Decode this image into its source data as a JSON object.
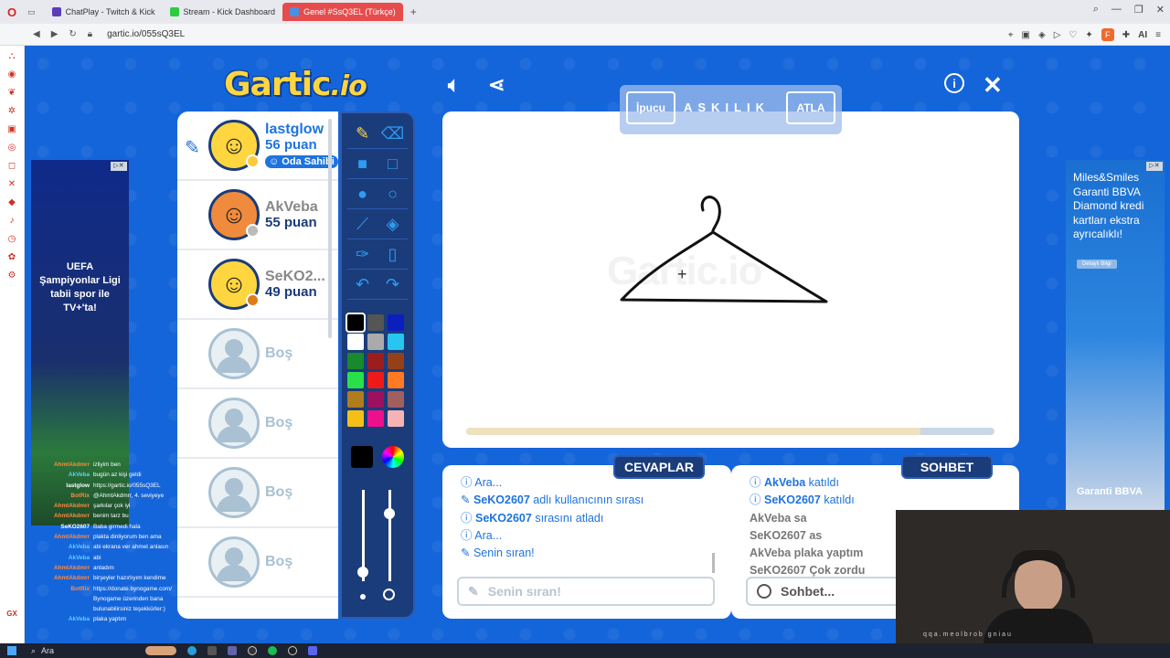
{
  "browser": {
    "tabs": [
      {
        "label": "ChatPlay - Twitch & Kick",
        "color": "#5a3db8",
        "active": false
      },
      {
        "label": "Stream - Kick Dashboard",
        "color": "#2ecc40",
        "active": false
      },
      {
        "label": "Genel #SsQ3EL (Türkçe)",
        "color": "#4a90e2",
        "active": true
      }
    ],
    "new_tab": "+",
    "url": "gartic.io/055sQ3EL",
    "ai_label": "AI"
  },
  "game": {
    "logo": "Gartic",
    "logo_suffix": ".io",
    "players": [
      {
        "name": "lastglow",
        "points": "56 puan",
        "badge": "Oda Sahibi",
        "status_color": "#ffc93c",
        "you": true,
        "avatar_color": "#ffd540"
      },
      {
        "name": "AkVeba",
        "points": "55 puan",
        "status_color": "#bbbbbb",
        "you": false,
        "avatar_color": "#f08a3c"
      },
      {
        "name": "SeKO2...",
        "points": "49 puan",
        "status_color": "#e07b1a",
        "you": false,
        "avatar_color": "#ffd540"
      }
    ],
    "empty_slots": [
      "Boş",
      "Boş",
      "Boş",
      "Boş"
    ],
    "palette": [
      "#000000",
      "#555555",
      "#0b1fbf",
      "#ffffff",
      "#aaaaaa",
      "#26c6f0",
      "#168a2c",
      "#9c1d1d",
      "#94411a",
      "#28e048",
      "#ee1a1a",
      "#ff7a22",
      "#b07c1c",
      "#9c1060",
      "#a06060",
      "#f4c018",
      "#ee0f8c",
      "#f6b3b3"
    ],
    "hint": {
      "hint_label": "İpucu",
      "secret_word": "ASKILIK",
      "skip_label": "ATLA"
    },
    "canvas_watermark": "Gartic.io",
    "timer_progress": 0.86,
    "answers": {
      "header": "CEVAPLAR",
      "lines": [
        {
          "text": "Ara...",
          "style": "sys",
          "icon": "i"
        },
        {
          "user": "SeKO2607",
          "text": " adlı kullanıcının sırası",
          "style": "sys",
          "icon": "pencil"
        },
        {
          "user": "SeKO2607",
          "text": " sırasını atladı",
          "style": "sys",
          "icon": "i"
        },
        {
          "text": "Ara...",
          "style": "sys",
          "icon": "i"
        },
        {
          "text": "Senin sıran!",
          "style": "sys",
          "icon": "pencil"
        }
      ],
      "input_placeholder": "Senin sıran!"
    },
    "chat": {
      "header": "SOHBET",
      "lines": [
        {
          "user": "AkVeba",
          "text": " katıldı",
          "style": "sys"
        },
        {
          "user": "SeKO2607",
          "text": " katıldı",
          "style": "sys"
        },
        {
          "user": "AkVeba",
          "text": " sa",
          "style": "grey"
        },
        {
          "user": "SeKO2607",
          "text": " as",
          "style": "grey"
        },
        {
          "user": "AkVeba",
          "text": " plaka yaptım",
          "style": "grey"
        },
        {
          "user": "SeKO2607",
          "text": " Çok zordu",
          "style": "grey"
        }
      ],
      "input_placeholder": "Sohbet..."
    }
  },
  "ads": {
    "left": {
      "title": "UEFA",
      "line2": "Şampiyonlar Ligi",
      "line3": "tabii spor ile",
      "line4": "TV+'ta!"
    },
    "right": {
      "text": "Miles&Smiles Garanti BBVA Diamond kredi kartları ekstra ayrıcalıklı!",
      "button": "Detaylı Bilgi",
      "brand": "Garanti BBVA"
    }
  },
  "stream_chat": [
    {
      "user": "AhmtAkdmrr",
      "text": "izliyim ben",
      "color": "#ff8a3c"
    },
    {
      "user": "AkVeba",
      "text": "bugün az kişi geldi",
      "color": "#5fd0ff"
    },
    {
      "user": "lastglow",
      "text": "https://gartic.io/055sQ3EL",
      "color": "#ffffff"
    },
    {
      "user": "BotRix",
      "text": "@AhmtAkdmrr, 4. seviyeye",
      "color": "#ff8a3c"
    },
    {
      "user": "AhmtAkdmrr",
      "text": "şarkılar çok iyi",
      "color": "#ff8a3c"
    },
    {
      "user": "AhmtAkdmrr",
      "text": "benim tarz bu",
      "color": "#ff8a3c"
    },
    {
      "user": "SeKO2607",
      "text": "Baba girmedi hala",
      "color": "#ffffff"
    },
    {
      "user": "AhmtAkdmrr",
      "text": "plakta dinliyorum ben ama",
      "color": "#ff8a3c"
    },
    {
      "user": "AkVeba",
      "text": "abi ekrana ver ahmet anlasın",
      "color": "#5fd0ff"
    },
    {
      "user": "AkVeba",
      "text": "abi",
      "color": "#5fd0ff"
    },
    {
      "user": "AhmtAkdmrr",
      "text": "anladım",
      "color": "#ff8a3c"
    },
    {
      "user": "AhmtAkdmrr",
      "text": "birşeyler hazırlıyım kendime",
      "color": "#ff8a3c"
    },
    {
      "user": "BotRix",
      "text": "https://donate.bynogame.com/",
      "color": "#ff8a3c"
    },
    {
      "user": "",
      "text": "Bynogame üzerinden bana",
      "color": "#ffffff"
    },
    {
      "user": "",
      "text": "bulunabilirsiniz teşekkürler:)",
      "color": "#ffffff"
    },
    {
      "user": "AkVeba",
      "text": "plaka yaptım",
      "color": "#5fd0ff"
    }
  ],
  "taskbar": {
    "search": "Ara"
  },
  "webcam": {
    "caption": "qqa.meolbrob gniau"
  }
}
